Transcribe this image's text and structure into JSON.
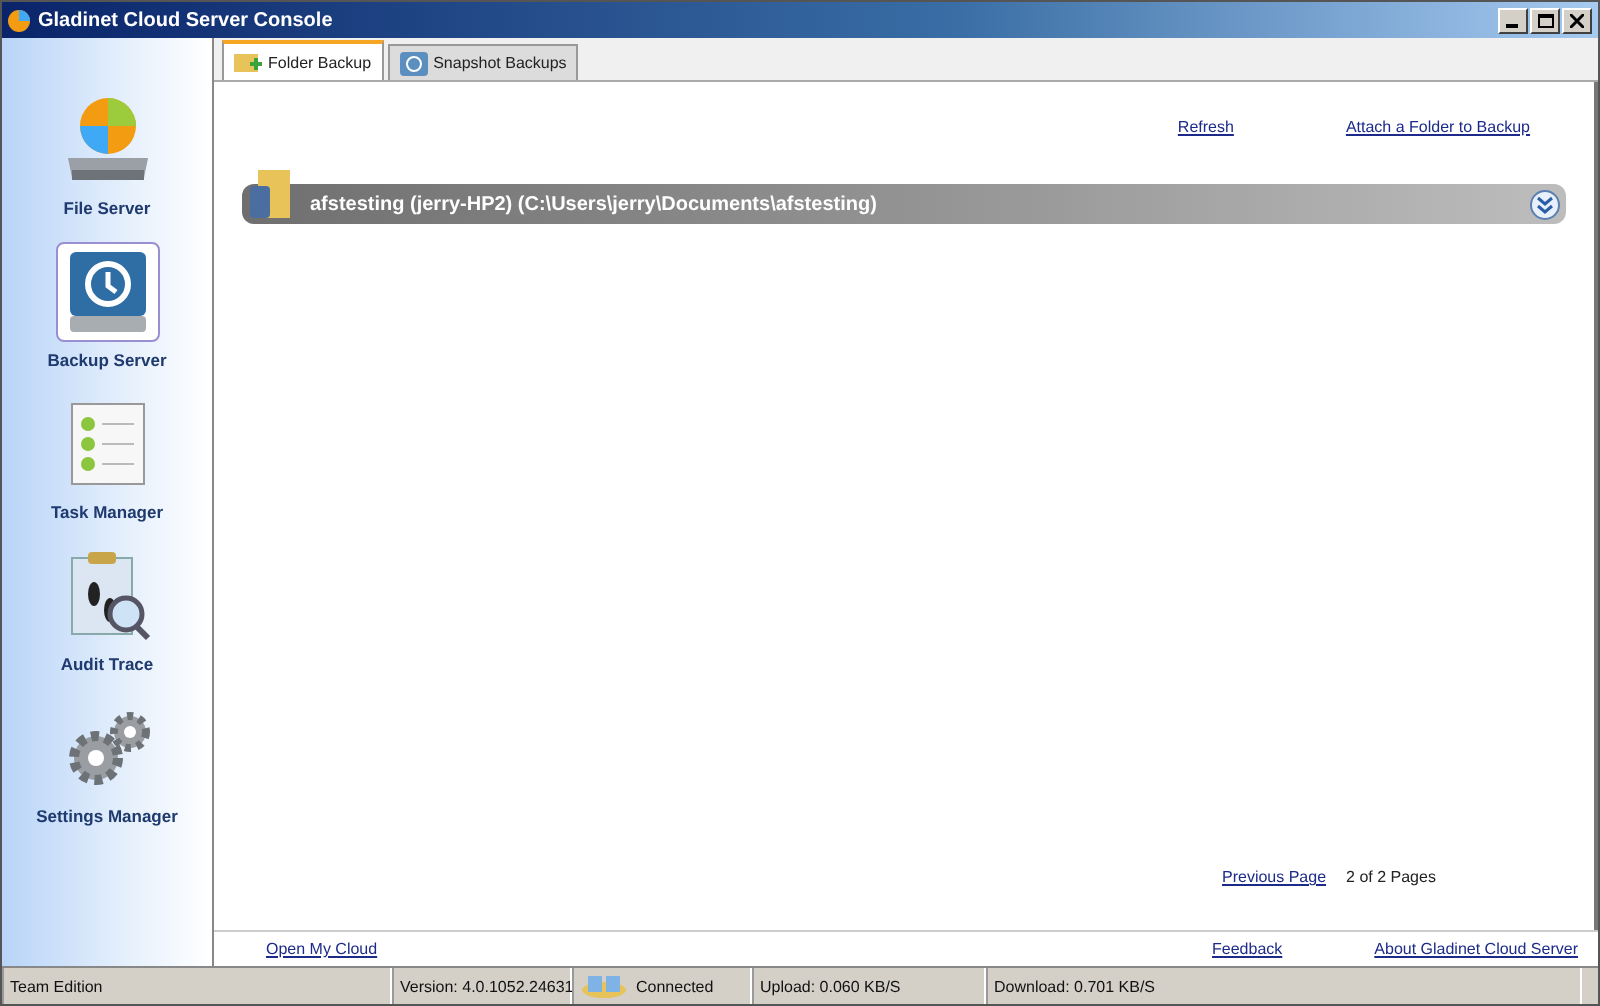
{
  "window": {
    "title": "Gladinet Cloud Server Console"
  },
  "sidebar": {
    "items": [
      {
        "label": "File Server",
        "kind": "drive",
        "selected": false
      },
      {
        "label": "Backup Server",
        "kind": "backup",
        "selected": true
      },
      {
        "label": "Task Manager",
        "kind": "tasks",
        "selected": false
      },
      {
        "label": "Audit Trace",
        "kind": "audit",
        "selected": false
      },
      {
        "label": "Settings Manager",
        "kind": "gears",
        "selected": false
      }
    ]
  },
  "tabs": [
    {
      "label": "Folder Backup",
      "kind": "folder",
      "selected": true
    },
    {
      "label": "Snapshot Backups",
      "kind": "snapshot",
      "selected": false
    }
  ],
  "actions": [
    "Refresh",
    "Attach a Folder to Backup"
  ],
  "backups": [
    {
      "label": "afstesting (jerry-HP2) (C:\\Users\\jerry\\Documents\\afstesting)",
      "expanded": false
    }
  ],
  "pager": {
    "link": "Previous Page",
    "text": "2 of 2 Pages"
  },
  "footer_links": {
    "left": "Open My Cloud",
    "right": [
      "Feedback",
      "About Gladinet Cloud Server"
    ]
  },
  "status_bar": {
    "edition": "Team Edition",
    "version": "Version: 4.0.1052.24631",
    "connection": "Connected",
    "upload": "Upload: 0.060 KB/S",
    "download": "Download: 0.701 KB/S"
  }
}
